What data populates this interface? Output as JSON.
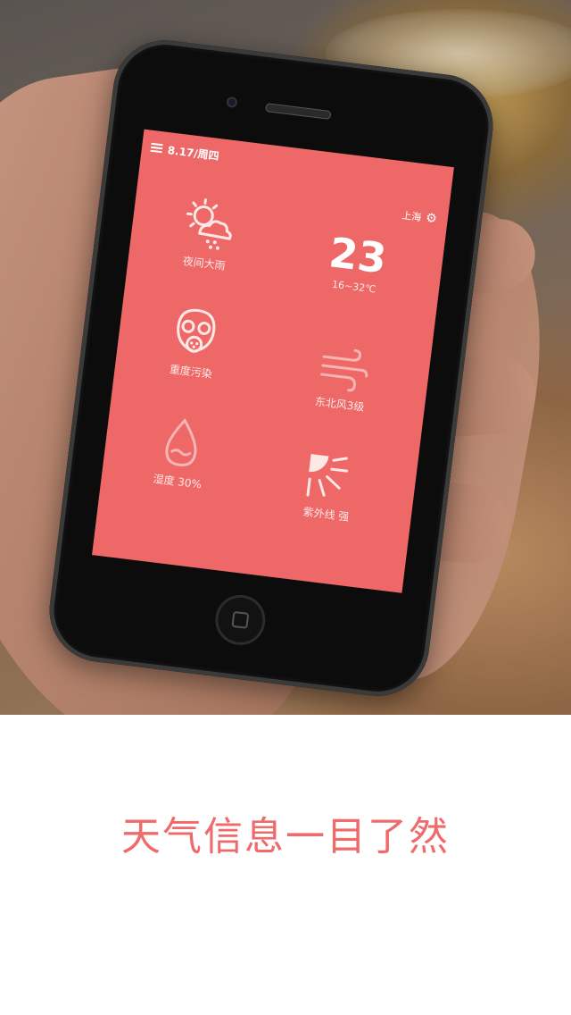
{
  "status_bar": {
    "date": "8.17/周四"
  },
  "location": {
    "city": "上海"
  },
  "weather": {
    "condition": "夜间大雨",
    "temperature": "23",
    "range": "16~32℃",
    "pollution": "重度污染",
    "wind": "东北风3级",
    "humidity": "湿度 30%",
    "uv": "紫外线 强"
  },
  "caption": "天气信息一目了然",
  "colors": {
    "accent": "#ee6868",
    "caption": "#ef6a6a",
    "icon_stroke": "#fde8e6"
  },
  "icons": [
    "menu-icon",
    "gear-icon",
    "weather-rain-sun-icon",
    "gas-mask-icon",
    "wind-icon",
    "humidity-drop-icon",
    "uv-sun-icon"
  ]
}
